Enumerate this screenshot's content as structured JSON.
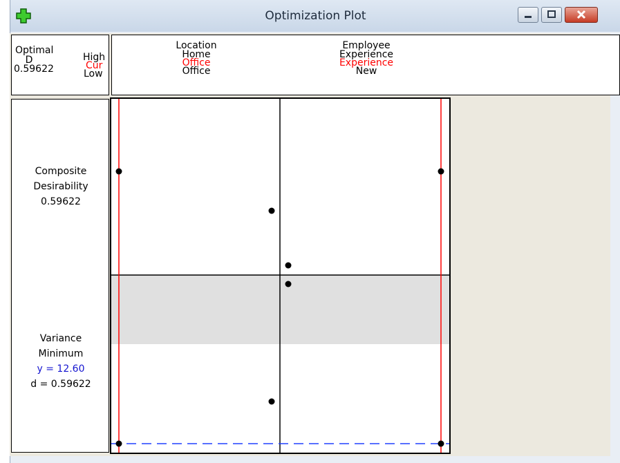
{
  "window": {
    "title": "Optimization Plot"
  },
  "legend": {
    "optimal": "Optimal",
    "d": "D",
    "d_value": "0.59622",
    "high": "High",
    "cur": "Cur",
    "low": "Low"
  },
  "factors": [
    {
      "name": "Location",
      "high": "Home",
      "cur": "Office",
      "low": "Office"
    },
    {
      "name": "Employee",
      "high_1": "Experience",
      "cur": "Experience",
      "low": "New"
    }
  ],
  "composite": {
    "line1": "Composite",
    "line2": "Desirability",
    "value": "0.59622"
  },
  "response": {
    "name": "Variance",
    "goal": "Minimum",
    "y": "y = 12.60",
    "d": "d = 0.59622"
  },
  "colors": {
    "current_line": "#ff0000",
    "cur_text": "#ff0000",
    "y_text": "#1515d0",
    "shade": "#e0e0e0"
  },
  "icons": {
    "app": "green-cross-icon",
    "minimize": "minimize-icon",
    "maximize": "maximize-icon",
    "close": "close-icon"
  }
}
